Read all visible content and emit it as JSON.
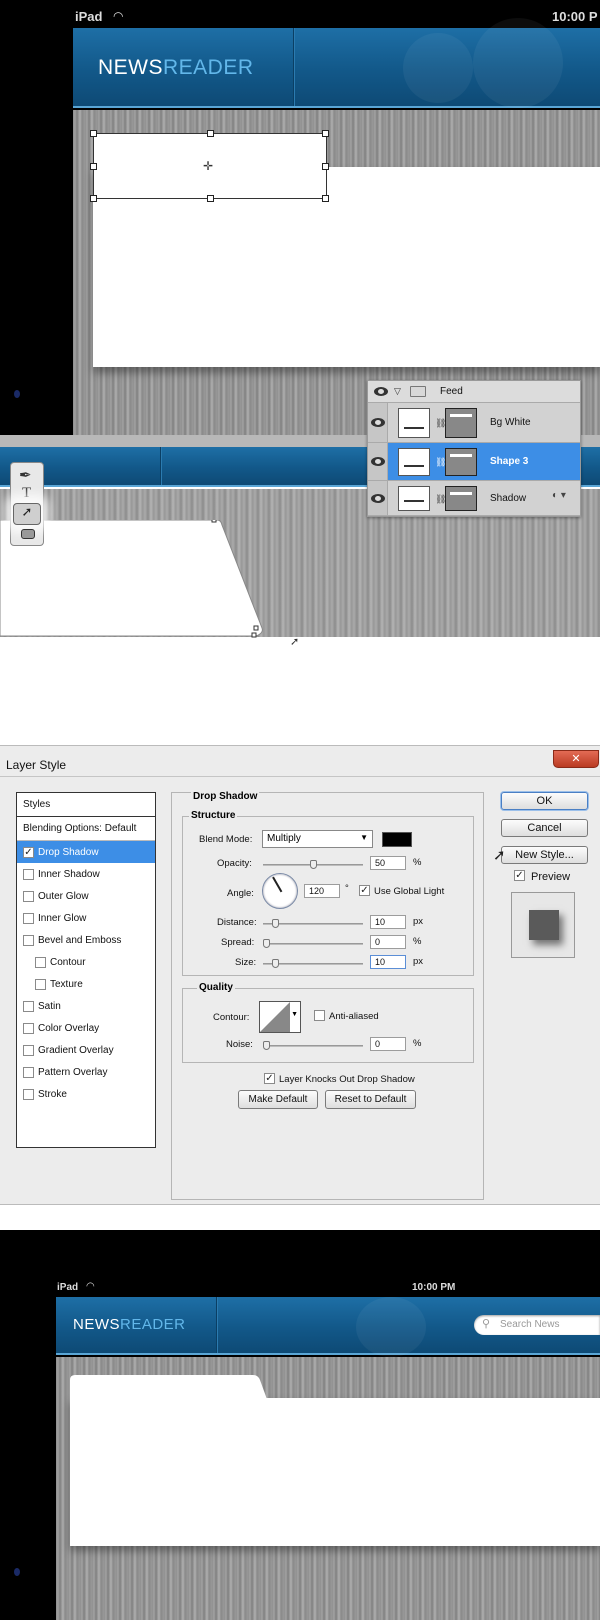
{
  "section1": {
    "status_device": "iPad",
    "status_time": "10:00 P",
    "logo_a": "NEWS",
    "logo_b": "READER"
  },
  "layers_panel": {
    "group_name": "Feed",
    "layers": [
      {
        "name": "Bg White",
        "selected": false
      },
      {
        "name": "Shape 3",
        "selected": true
      },
      {
        "name": "Shadow",
        "selected": false
      }
    ]
  },
  "tools": [
    "pen-tool-icon",
    "type-tool-icon",
    "direct-selection-tool-icon",
    "rounded-rectangle-tool-icon"
  ],
  "dialog": {
    "title": "Layer Style",
    "close": "✕",
    "styles_header": "Styles",
    "blending_options": "Blending Options: Default",
    "style_items": [
      {
        "label": "Drop Shadow",
        "checked": true,
        "active": true,
        "indent": false
      },
      {
        "label": "Inner Shadow",
        "checked": false,
        "active": false,
        "indent": false
      },
      {
        "label": "Outer Glow",
        "checked": false,
        "active": false,
        "indent": false
      },
      {
        "label": "Inner Glow",
        "checked": false,
        "active": false,
        "indent": false
      },
      {
        "label": "Bevel and Emboss",
        "checked": false,
        "active": false,
        "indent": false
      },
      {
        "label": "Contour",
        "checked": false,
        "active": false,
        "indent": true
      },
      {
        "label": "Texture",
        "checked": false,
        "active": false,
        "indent": true
      },
      {
        "label": "Satin",
        "checked": false,
        "active": false,
        "indent": false
      },
      {
        "label": "Color Overlay",
        "checked": false,
        "active": false,
        "indent": false
      },
      {
        "label": "Gradient Overlay",
        "checked": false,
        "active": false,
        "indent": false
      },
      {
        "label": "Pattern Overlay",
        "checked": false,
        "active": false,
        "indent": false
      },
      {
        "label": "Stroke",
        "checked": false,
        "active": false,
        "indent": false
      }
    ],
    "section_title": "Drop Shadow",
    "structure_title": "Structure",
    "blend_mode_label": "Blend Mode:",
    "blend_mode_value": "Multiply",
    "shadow_color": "#000000",
    "opacity_label": "Opacity:",
    "opacity_value": "50",
    "opacity_unit": "%",
    "angle_label": "Angle:",
    "angle_value": "120",
    "angle_unit": "°",
    "global_light_label": "Use Global Light",
    "distance_label": "Distance:",
    "distance_value": "10",
    "distance_unit": "px",
    "spread_label": "Spread:",
    "spread_value": "0",
    "spread_unit": "%",
    "size_label": "Size:",
    "size_value": "10",
    "size_unit": "px",
    "quality_title": "Quality",
    "contour_label": "Contour:",
    "antialiased_label": "Anti-aliased",
    "noise_label": "Noise:",
    "noise_value": "0",
    "noise_unit": "%",
    "knockout_label": "Layer Knocks Out Drop Shadow",
    "make_default": "Make Default",
    "reset_default": "Reset to Default",
    "ok": "OK",
    "cancel": "Cancel",
    "new_style": "New Style...",
    "preview_label": "Preview",
    "slider_levels": {
      "opacity": 0.5,
      "distance": 0.1,
      "spread": 0.0,
      "size": 0.1,
      "noise": 0.0
    }
  },
  "section4": {
    "status_device": "iPad",
    "status_time": "10:00 PM",
    "logo_a": "NEWS",
    "logo_b": "READER",
    "search_placeholder": "Search News"
  }
}
